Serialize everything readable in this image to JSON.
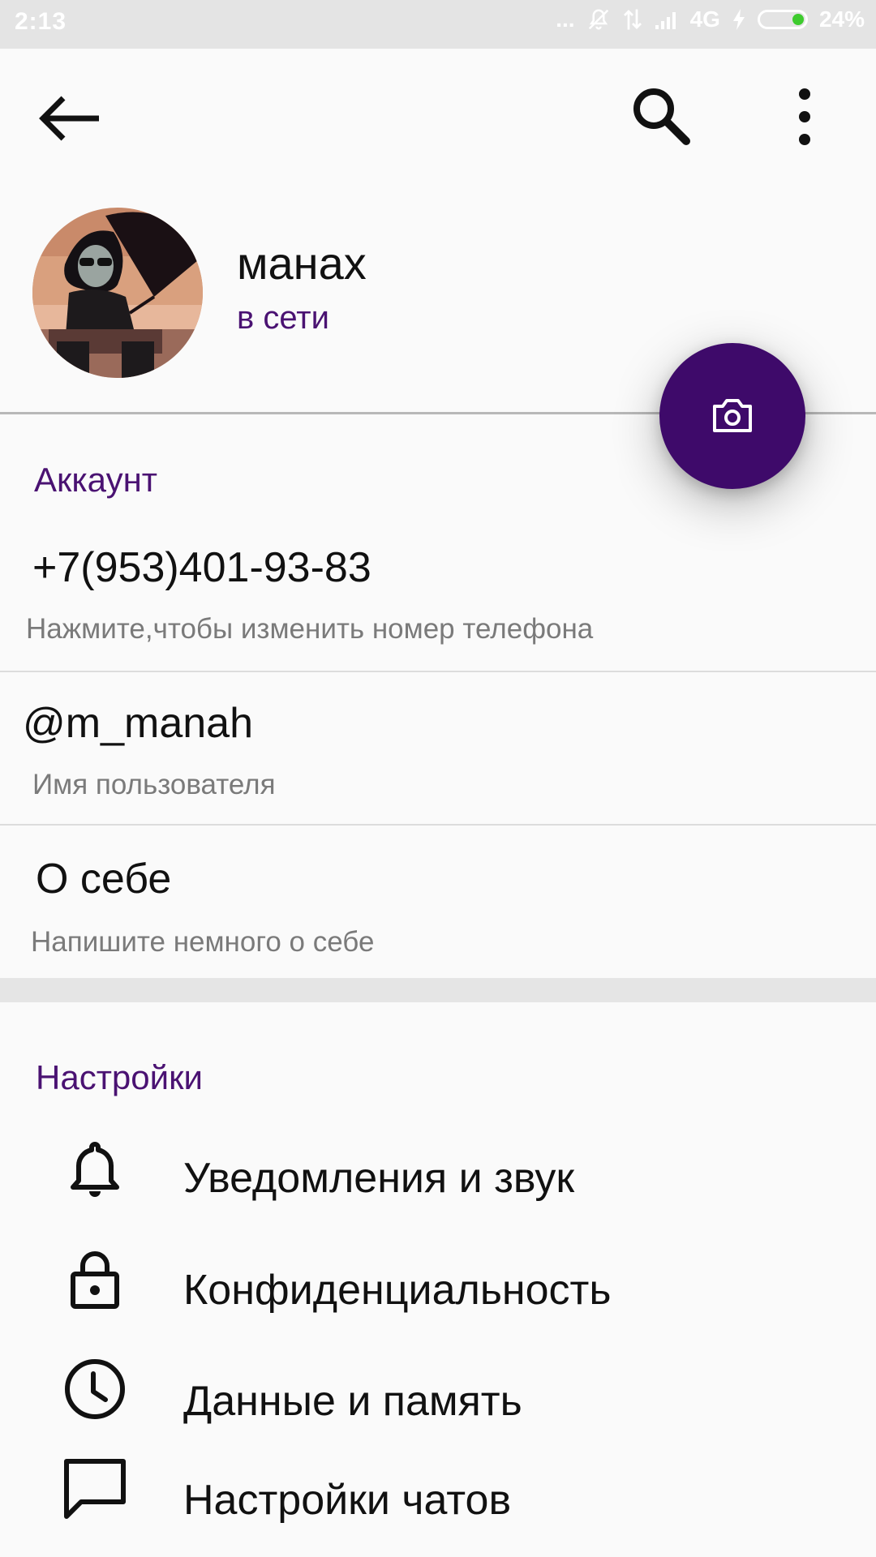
{
  "status_bar": {
    "time": "2:13",
    "dots": "...",
    "network": "4G",
    "battery": "24%"
  },
  "toolbar": {
    "back_icon": "arrow-left-icon",
    "search_icon": "search-icon",
    "more_icon": "more-vert-icon"
  },
  "profile": {
    "name": "манах",
    "status": "в сети",
    "camera_icon": "camera-icon"
  },
  "account": {
    "title": "Аккаунт",
    "phone": "+7(953)401-93-83",
    "phone_hint": "Нажмите,чтобы изменить номер телефона",
    "username": "@m_manah",
    "username_hint": "Имя пользователя",
    "bio": "О себе",
    "bio_hint": "Напишите немного о себе"
  },
  "settings": {
    "title": "Настройки",
    "items": [
      {
        "label": "Уведомления и звук",
        "icon": "bell-icon"
      },
      {
        "label": "Конфиденциальность",
        "icon": "lock-icon"
      },
      {
        "label": "Данные и память",
        "icon": "clock-icon"
      },
      {
        "label": "Настройки чатов",
        "icon": "chat-bubble-icon"
      }
    ]
  },
  "colors": {
    "accent": "#4a1272",
    "fab": "#3e0a6a",
    "status_bar": "#e4e4e4",
    "battery_fill": "#3ecb2e"
  }
}
